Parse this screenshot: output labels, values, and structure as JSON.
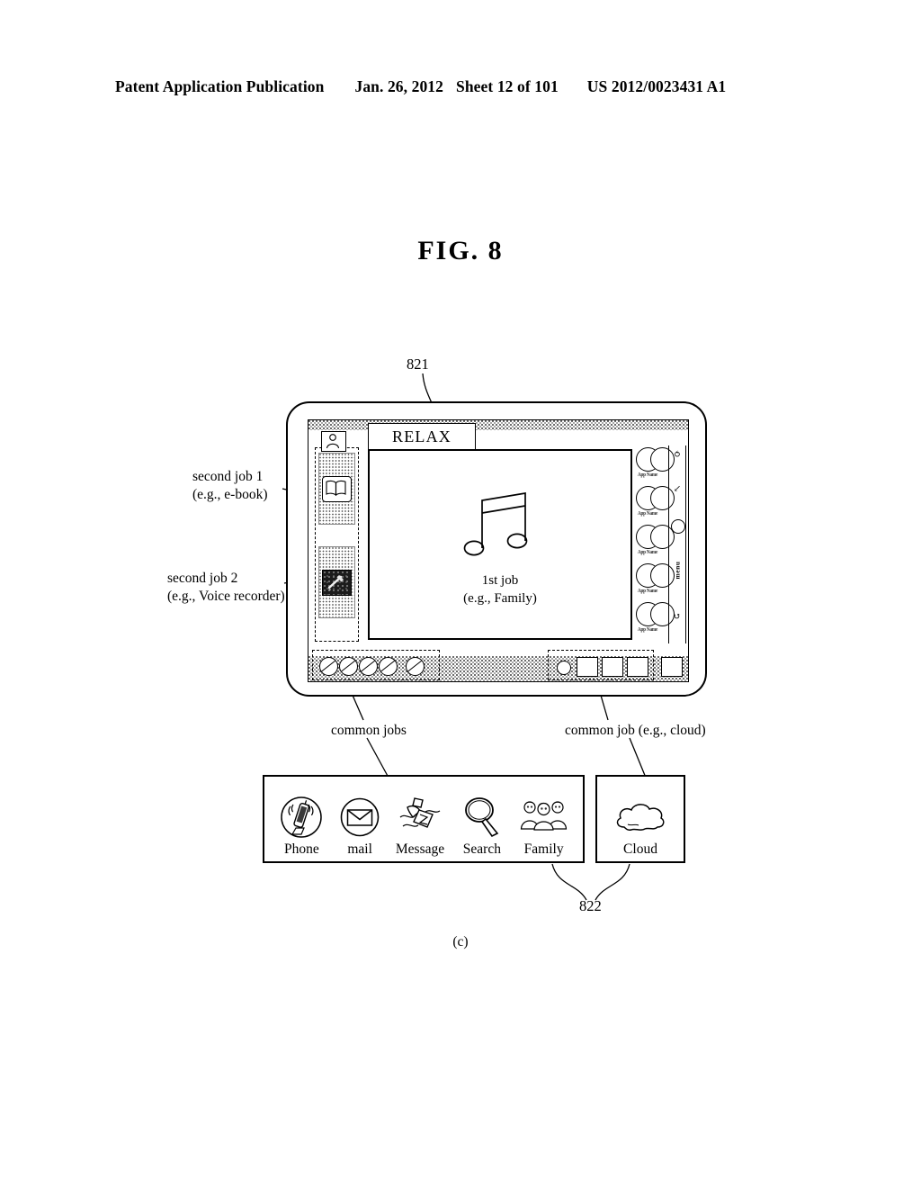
{
  "header": {
    "publication": "Patent Application Publication",
    "date": "Jan. 26, 2012",
    "sheet": "Sheet 12 of 101",
    "number": "US 2012/0023431 A1"
  },
  "figure": {
    "title": "FIG. 8",
    "subfigure": "(c)"
  },
  "callouts": {
    "ref_821": "821",
    "ref_822": "822",
    "second_job_1_line1": "second job 1",
    "second_job_1_line2": "(e.g., e-book)",
    "second_job_2_line1": "second job 2",
    "second_job_2_line2": "(e.g., Voice recorder)",
    "common_jobs": "common jobs",
    "common_job_cloud": "common job (e.g., cloud)"
  },
  "device": {
    "title_bar_label": "RELAX",
    "avatar_icon": "person-icon",
    "sidebar": {
      "jobs": [
        {
          "icon": "ebook-icon",
          "name": "second-job-1-ebook"
        },
        {
          "icon": "voice-recorder-icon",
          "name": "second-job-2-voice-recorder"
        }
      ]
    },
    "content": {
      "icon": "music-note-icon",
      "caption_line1": "1st job",
      "caption_line2": "(e.g., Family)"
    },
    "app_list": [
      {
        "label": "App Name"
      },
      {
        "label": "App Name"
      },
      {
        "label": "App Name"
      },
      {
        "label": "App Name"
      },
      {
        "label": "App Name"
      }
    ],
    "bezel": {
      "glyph_top": "⥀",
      "glyph_second": "↙",
      "home_icon": "home-circle-icon",
      "menu_label": "menu",
      "glyph_bottom": "↺"
    },
    "taskbar": {
      "common_job_count": 5,
      "cloud_group_count": 3,
      "extra_square_count": 1
    }
  },
  "legend": {
    "common_jobs": [
      {
        "label": "Phone",
        "icon": "phone-icon"
      },
      {
        "label": "mail",
        "icon": "mail-envelope-icon"
      },
      {
        "label": "Message",
        "icon": "message-hand-icon"
      },
      {
        "label": "Search",
        "icon": "magnifier-icon"
      },
      {
        "label": "Family",
        "icon": "family-group-icon"
      }
    ],
    "cloud": {
      "label": "Cloud",
      "icon": "cloud-icon"
    }
  },
  "colors": {
    "ink": "#000000",
    "paper": "#ffffff",
    "stipple": "#555555"
  }
}
